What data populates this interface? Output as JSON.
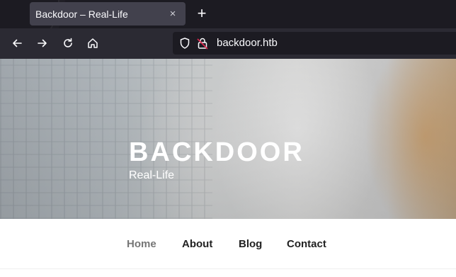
{
  "browser": {
    "tab": {
      "title": "Backdoor – Real-Life",
      "close_icon": "×"
    },
    "new_tab_icon": "+",
    "url": "backdoor.htb"
  },
  "site": {
    "title": "BACKDOOR",
    "tagline": "Real-Life"
  },
  "menu": {
    "items": [
      {
        "label": "Home",
        "current": true
      },
      {
        "label": "About"
      },
      {
        "label": "Blog"
      },
      {
        "label": "Contact"
      }
    ]
  },
  "colors": {
    "tabbar_bg": "#1c1b22",
    "navbar_bg": "#2b2a33",
    "tab_bg": "#42414d",
    "lock_warning": "#e22850",
    "menu_current": "#767676",
    "menu_text": "#222222"
  }
}
